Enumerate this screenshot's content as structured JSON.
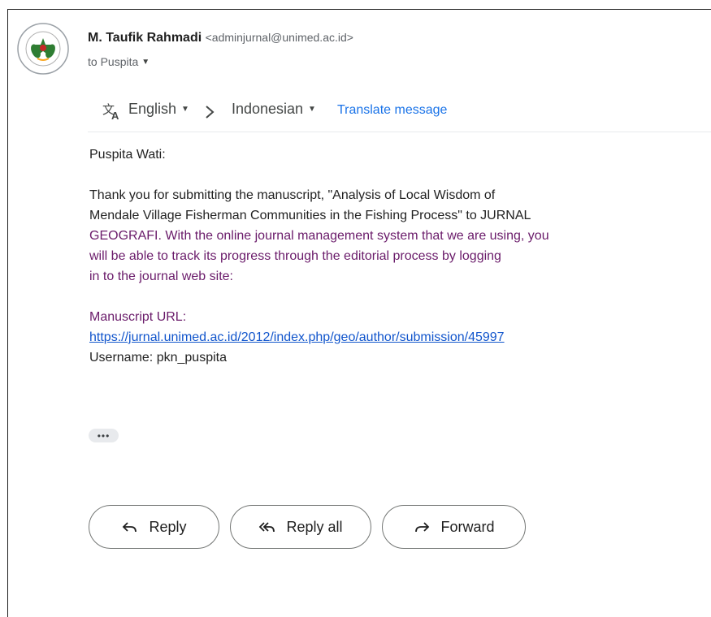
{
  "message": {
    "sender_name": "M. Taufik Rahmadi",
    "sender_email": "<adminjurnal@unimed.ac.id>",
    "recipient": "to Puspita"
  },
  "translate": {
    "from_lang": "English",
    "to_lang": "Indonesian",
    "action_label": "Translate message"
  },
  "body": {
    "greeting": "Puspita Wati:",
    "para1_line1": "Thank you for submitting the manuscript, \"Analysis of Local Wisdom of",
    "para1_line2": "Mendale Village Fisherman Communities in the Fishing Process\" to JURNAL",
    "para1_line3": "GEOGRAFI. With the online journal management system that we are using, you",
    "para1_line4": "will be able to track its progress through the editorial process by logging",
    "para1_line5": "in to the journal web site:",
    "url_label": "Manuscript URL:",
    "url": "https://jurnal.unimed.ac.id/2012/index.php/geo/author/submission/45997",
    "username": "Username: pkn_puspita",
    "show_trimmed": "•••"
  },
  "actions": {
    "reply": "Reply",
    "reply_all": "Reply all",
    "forward": "Forward"
  },
  "colors": {
    "link": "#1155cc",
    "translate_link": "#1a73e8",
    "quoted_purple": "#6a1b6a"
  }
}
